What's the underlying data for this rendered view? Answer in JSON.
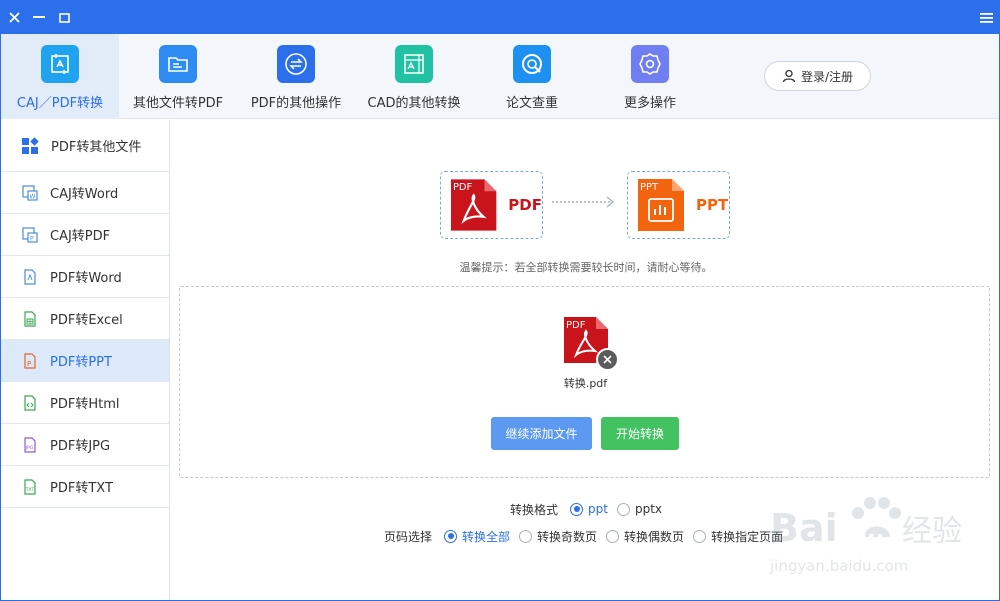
{
  "toolbar": {
    "tabs": [
      {
        "label": "CAJ／PDF转换",
        "icon": "caj-pdf-convert-icon",
        "color": "#1fa3f0"
      },
      {
        "label": "其他文件转PDF",
        "icon": "folder-icon",
        "color": "#2e8bf2"
      },
      {
        "label": "PDF的其他操作",
        "icon": "swap-icon",
        "color": "#2b6fea"
      },
      {
        "label": "CAD的其他转换",
        "icon": "cad-icon",
        "color": "#21c2a4"
      },
      {
        "label": "论文查重",
        "icon": "search-check-icon",
        "color": "#1e90f2"
      },
      {
        "label": "更多操作",
        "icon": "gear-icon",
        "color": "#6f7ef0"
      }
    ],
    "login_label": "登录/注册"
  },
  "sidebar": {
    "items": [
      {
        "label": "PDF转其他文件",
        "icon": "grid-icon"
      },
      {
        "label": "CAJ转Word",
        "icon": "caj-word-icon"
      },
      {
        "label": "CAJ转PDF",
        "icon": "caj-pdf-icon"
      },
      {
        "label": "PDF转Word",
        "icon": "pdf-file-icon"
      },
      {
        "label": "PDF转Excel",
        "icon": "excel-file-icon"
      },
      {
        "label": "PDF转PPT",
        "icon": "ppt-file-icon"
      },
      {
        "label": "PDF转Html",
        "icon": "html-file-icon"
      },
      {
        "label": "PDF转JPG",
        "icon": "jpg-file-icon"
      },
      {
        "label": "PDF转TXT",
        "icon": "txt-file-icon"
      }
    ],
    "active_index": 5
  },
  "main": {
    "source": {
      "badge": "PDF",
      "label": "PDF",
      "color": "#c9141b"
    },
    "target": {
      "badge": "PPT",
      "label": "PPT",
      "color": "#f2640e"
    },
    "hint": "温馨提示：若全部转换需要较长时间，请耐心等待。",
    "file": {
      "badge": "PDF",
      "name": "转换.pdf"
    },
    "add_button": "继续添加文件",
    "start_button": "开始转换",
    "format": {
      "label": "转换格式",
      "options": [
        "ppt",
        "pptx"
      ],
      "selected": "ppt"
    },
    "pages": {
      "label": "页码选择",
      "options": [
        "转换全部",
        "转换奇数页",
        "转换偶数页",
        "转换指定页面"
      ],
      "selected": "转换全部"
    }
  },
  "watermark": {
    "text": "Bai du 经验",
    "url_text": "jingyan.baidu.com"
  },
  "colors": {
    "accent": "#2b6fea",
    "start_green": "#43c262",
    "add_blue": "#5b9af0"
  }
}
